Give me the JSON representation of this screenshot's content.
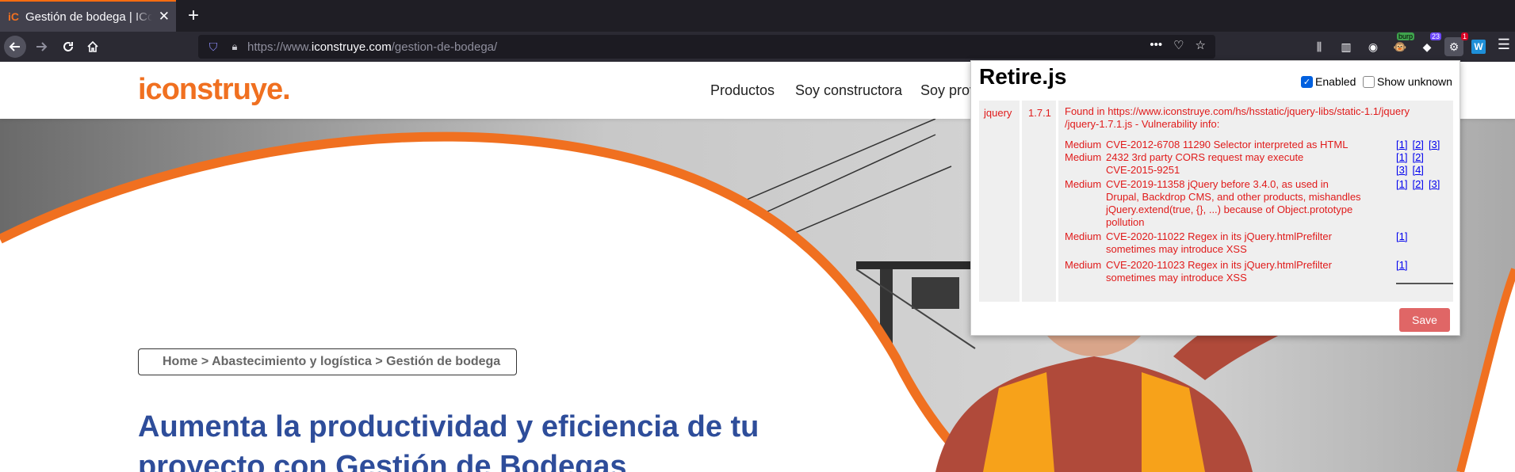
{
  "browser": {
    "tab_title": "Gestión de bodega | IConstruye",
    "tab_favicon": "iC",
    "new_tab_label": "+",
    "url_prefix": "https://www.",
    "url_domain": "iconstruye.com",
    "url_path": "/gestion-de-bodega/",
    "icons": {
      "back": "back-arrow-icon",
      "forward": "forward-arrow-icon",
      "reload": "reload-icon",
      "home": "home-icon"
    },
    "extension_badges": {
      "burp": "burp",
      "ublock_count": "23",
      "retire_count": "1"
    },
    "w_extension": "W"
  },
  "site": {
    "logo": "iconstruye.",
    "nav": [
      "Productos",
      "Soy constructora",
      "Soy prov"
    ],
    "breadcrumb": "Home > Abastecimiento y logística > Gestión de bodega",
    "headline_line1": "Aumenta la productividad y eficiencia de tu",
    "headline_line2": "proyecto con Gestión de Bodegas",
    "colors": {
      "brand_orange": "#f07020",
      "headline_blue": "#2e4d9a"
    }
  },
  "retire": {
    "title": "Retire.js",
    "enabled_label": "Enabled",
    "show_unknown_label": "Show unknown",
    "library": "jquery",
    "version": "1.7.1",
    "found_line1": "Found in https://www.iconstruye.com/hs/hsstatic/jquery-libs/static-1.1/jquery",
    "found_line2": "/jquery-1.7.1.js - Vulnerability info:",
    "vulns": [
      {
        "severity": "Medium",
        "desc": [
          "CVE-2012-6708 11290 Selector interpreted as HTML"
        ],
        "refs": [
          "[1]",
          "[2]",
          "[3]"
        ]
      },
      {
        "severity": "Medium",
        "desc": [
          "2432 3rd party CORS request may execute",
          "CVE-2015-9251"
        ],
        "refs": [
          "[1]",
          "[2]",
          "[3]",
          "[4]"
        ]
      },
      {
        "severity": "Medium",
        "desc": [
          "CVE-2019-11358 jQuery before 3.4.0, as used in",
          "Drupal, Backdrop CMS, and other products, mishandles",
          "jQuery.extend(true, {}, ...) because of Object.prototype",
          "pollution"
        ],
        "refs": [
          "[1]",
          "[2]",
          "[3]"
        ]
      },
      {
        "severity": "Medium",
        "desc": [
          "CVE-2020-11022 Regex in its jQuery.htmlPrefilter",
          "sometimes may introduce XSS"
        ],
        "refs": [
          "[1]"
        ]
      },
      {
        "severity": "Medium",
        "desc": [
          "CVE-2020-11023 Regex in its jQuery.htmlPrefilter",
          "sometimes may introduce XSS"
        ],
        "refs": [
          "[1]"
        ]
      }
    ],
    "save_label": "Save",
    "colors": {
      "vuln_red": "#e01b1b",
      "save_bg": "#e06666"
    }
  }
}
